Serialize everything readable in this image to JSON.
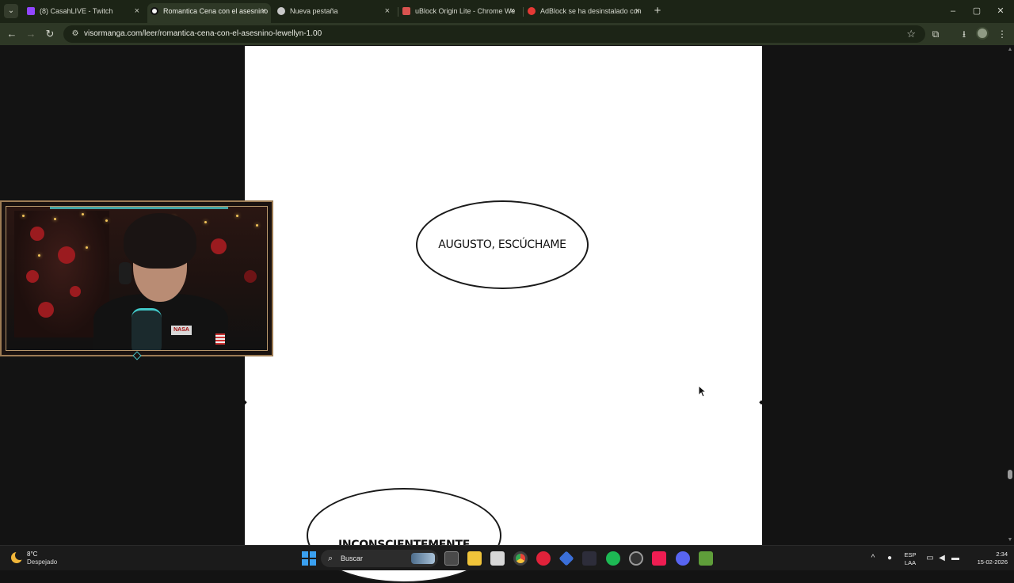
{
  "browser": {
    "tabs": [
      {
        "title": "(8) CasahLIVE - Twitch",
        "icon": "twitch-icon",
        "active": false,
        "color": "#9146ff"
      },
      {
        "title": "Romantica Cena con el asesnino",
        "icon": "visormanga-icon",
        "active": true,
        "color": "#ffffff"
      },
      {
        "title": "Nueva pestaña",
        "icon": "chrome-icon",
        "active": false,
        "color": "#c8c8c8"
      },
      {
        "title": "uBlock Origin Lite - Chrome We",
        "icon": "chrome-web-store-icon",
        "active": false,
        "color": "#d9534f"
      },
      {
        "title": "AdBlock se ha desinstalado con",
        "icon": "adblock-icon",
        "active": false,
        "color": "#e53935"
      }
    ],
    "tab_close_glyph": "×",
    "new_tab_glyph": "+",
    "window_controls": {
      "minimize": "–",
      "maximize": "▢",
      "close": "✕"
    },
    "toolbar": {
      "back": "←",
      "forward": "→",
      "reload": "↻",
      "site_info": "⚙",
      "url": "visormanga.com/leer/romantica-cena-con-el-asesnino-lewellyn-1.00",
      "bookmark": "☆",
      "extensions": "⧉",
      "download": "⭳",
      "menu": "⋮"
    },
    "accent_color": "#2e3826"
  },
  "page": {
    "bubble_1": "AUGUSTO, ESCÚCHAME",
    "bubble_2": "INCONSCIENTEMENTE",
    "scroll_up": "▲",
    "scroll_down": "▼"
  },
  "taskbar": {
    "weather_temp": "8°C",
    "weather_condition": "Despejado",
    "search_placeholder": "Buscar",
    "search_glyph": "⌕",
    "tray_chevron": "^",
    "language_1": "ESP",
    "language_2": "LAA",
    "time": "2:34",
    "date": "15-02-2026",
    "pinned_icons": [
      "task-view-icon",
      "file-explorer-icon",
      "microsoft-store-icon",
      "chrome-icon",
      "opera-icon",
      "visual-studio-icon",
      "obs-icon",
      "spotify-icon",
      "steam-icon",
      "tiktok-icon",
      "discord-icon",
      "minecraft-icon"
    ]
  }
}
